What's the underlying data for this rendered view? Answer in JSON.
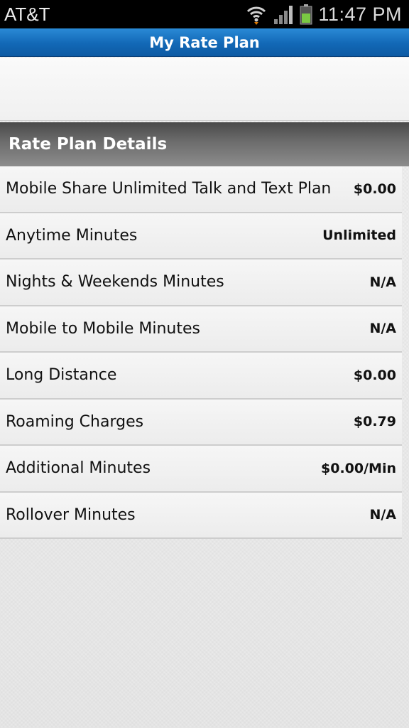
{
  "status_bar": {
    "carrier": "AT&T",
    "time": "11:47 PM",
    "icons": [
      "wifi-icon",
      "signal-icon",
      "battery-icon"
    ],
    "battery_color": "#7ac943"
  },
  "header": {
    "title": "My Rate Plan",
    "color": "#1268b6"
  },
  "section": {
    "title": "Rate Plan Details"
  },
  "rows": [
    {
      "label": "Mobile Share Unlimited Talk and Text Plan",
      "value": "$0.00"
    },
    {
      "label": "Anytime Minutes",
      "value": "Unlimited"
    },
    {
      "label": "Nights & Weekends Minutes",
      "value": "N/A"
    },
    {
      "label": "Mobile to Mobile Minutes",
      "value": "N/A"
    },
    {
      "label": "Long Distance",
      "value": "$0.00"
    },
    {
      "label": "Roaming Charges",
      "value": "$0.79"
    },
    {
      "label": "Additional Minutes",
      "value": "$0.00/Min"
    },
    {
      "label": "Rollover Minutes",
      "value": "N/A"
    }
  ]
}
